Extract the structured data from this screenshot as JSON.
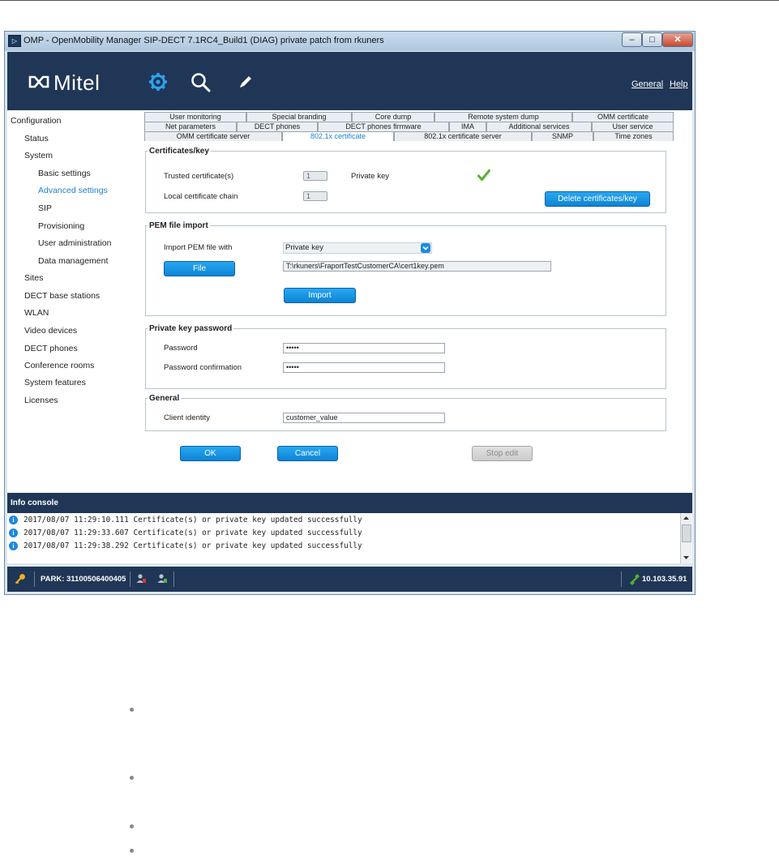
{
  "window": {
    "title": "OMP - OpenMobility Manager SIP-DECT 7.1RC4_Build1 (DIAG) private patch from rkuners",
    "app_icon_label": "▷",
    "buttons": {
      "minimize": "–",
      "maximize": "□",
      "close": "✕"
    }
  },
  "header": {
    "logo_text": "Mitel",
    "icons": [
      "gear-icon",
      "search-icon",
      "pencil-icon"
    ],
    "links": {
      "general": "General",
      "help": "Help"
    }
  },
  "sidebar": {
    "items": [
      {
        "label": "Configuration",
        "level": 0
      },
      {
        "label": "Status",
        "level": 1
      },
      {
        "label": "System",
        "level": 1
      },
      {
        "label": "Basic settings",
        "level": 2
      },
      {
        "label": "Advanced settings",
        "level": 2,
        "active": true
      },
      {
        "label": "SIP",
        "level": 2
      },
      {
        "label": "Provisioning",
        "level": 2
      },
      {
        "label": "User administration",
        "level": 2
      },
      {
        "label": "Data management",
        "level": 2
      },
      {
        "label": "Sites",
        "level": 1
      },
      {
        "label": "DECT base stations",
        "level": 1
      },
      {
        "label": "WLAN",
        "level": 1
      },
      {
        "label": "Video devices",
        "level": 1
      },
      {
        "label": "DECT phones",
        "level": 1
      },
      {
        "label": "Conference rooms",
        "level": 1
      },
      {
        "label": "System features",
        "level": 1
      },
      {
        "label": "Licenses",
        "level": 1
      }
    ]
  },
  "tabs": {
    "row1": [
      "User monitoring",
      "Special branding",
      "Core dump",
      "Remote system dump",
      "OMM certificate"
    ],
    "row2": [
      "Net parameters",
      "DECT phones",
      "DECT phones firmware",
      "IMA",
      "Additional services",
      "User service"
    ],
    "row3": [
      "OMM certificate server",
      "802.1x certificate",
      "802.1x certificate server",
      "SNMP",
      "Time zones"
    ],
    "active": "802.1x certificate"
  },
  "certificates": {
    "legend": "Certificates/key",
    "trusted_label": "Trusted certificate(s)",
    "trusted_value": "1",
    "local_chain_label": "Local certificate chain",
    "local_chain_value": "1",
    "private_key_label": "Private key",
    "private_key_status_icon": "checkmark-icon",
    "delete_button": "Delete certificates/key"
  },
  "pem_import": {
    "legend": "PEM file import",
    "import_with_label": "Import PEM file with",
    "import_with_value": "Private key",
    "file_button": "File",
    "file_path": "T:\\rkuners\\FraportTestCustomerCA\\cert1key.pem",
    "import_button": "Import"
  },
  "private_key_password": {
    "legend": "Private key password",
    "password_label": "Password",
    "password_value": "•••••",
    "confirm_label": "Password confirmation",
    "confirm_value": "•••••"
  },
  "general": {
    "legend": "General",
    "client_identity_label": "Client identity",
    "client_identity_value": "customer_value"
  },
  "actions": {
    "ok": "OK",
    "cancel": "Cancel",
    "stop_edit": "Stop edit"
  },
  "info_console": {
    "title": "Info console",
    "logs": [
      "2017/08/07 11:29:10.111 Certificate(s) or private key updated successfully",
      "2017/08/07 11:29:33.607 Certificate(s) or private key updated successfully",
      "2017/08/07 11:29:38.292 Certificate(s) or private key updated successfully"
    ]
  },
  "status_bar": {
    "park": "PARK: 31100506400405",
    "ip": "10.103.35.91"
  },
  "colors": {
    "header_bg": "#1f3656",
    "accent_blue": "#1f7fd0",
    "button_blue": "#0d84d6",
    "check_green": "#58b22c"
  }
}
